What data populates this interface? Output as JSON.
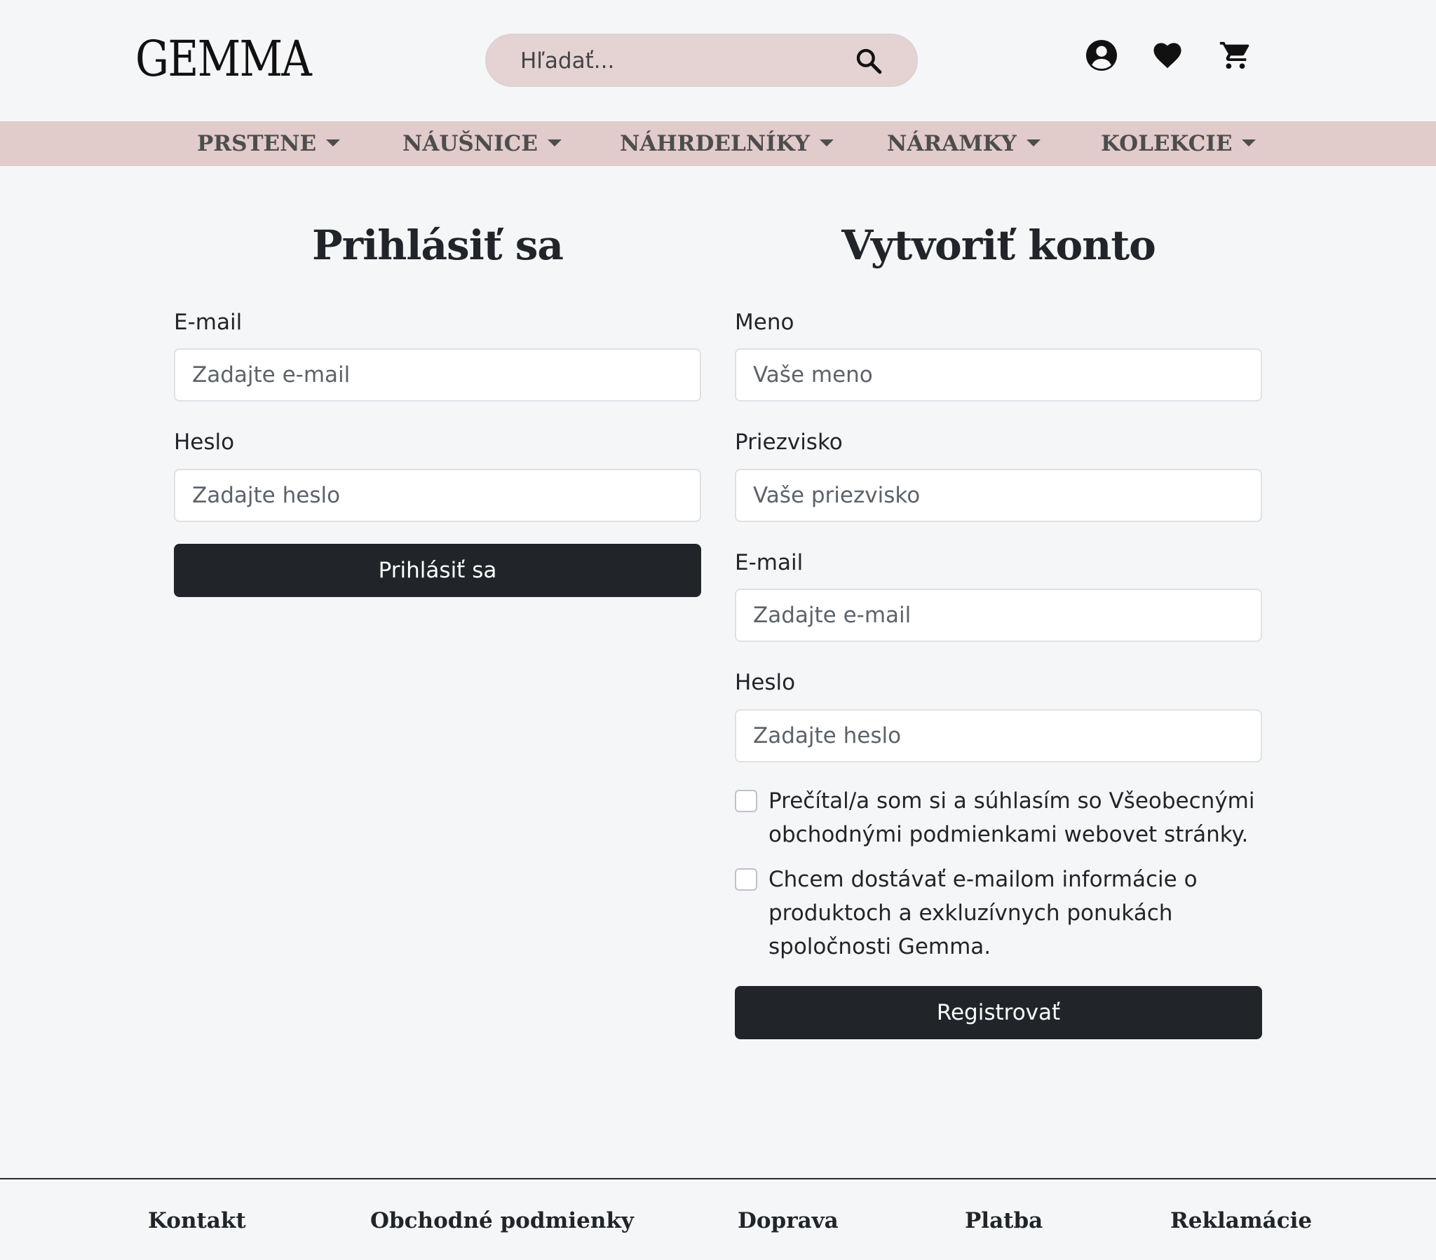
{
  "brand": {
    "logo": "GEMMA"
  },
  "search": {
    "placeholder": "Hľadať..."
  },
  "header_icons": [
    "account-icon",
    "heart-icon",
    "cart-icon"
  ],
  "nav": {
    "items": [
      {
        "label": "PRSTENE"
      },
      {
        "label": "NÁUŠNICE"
      },
      {
        "label": "NÁHRDELNÍKY"
      },
      {
        "label": "NÁRAMKY"
      },
      {
        "label": "KOLEKCIE"
      }
    ]
  },
  "login": {
    "title": "Prihlásiť sa",
    "email_label": "E-mail",
    "email_placeholder": "Zadajte e-mail",
    "password_label": "Heslo",
    "password_placeholder": "Zadajte heslo",
    "submit_label": "Prihlásiť sa"
  },
  "register": {
    "title": "Vytvoriť konto",
    "name_label": "Meno",
    "name_placeholder": "Vaše meno",
    "surname_label": "Priezvisko",
    "surname_placeholder": "Vaše priezvisko",
    "email_label": "E-mail",
    "email_placeholder": "Zadajte e-mail",
    "password_label": "Heslo",
    "password_placeholder": "Zadajte heslo",
    "terms_text": "Prečítal/a som si a súhlasím so Všeobecnými obchodnými podmienkami webovet stránky.",
    "newsletter_text": "Chcem dostávať e-mailom informácie o produktoch a exkluzívnych ponukách spoločnosti Gemma.",
    "submit_label": "Registrovať"
  },
  "footer": {
    "links": [
      "Kontakt",
      "Obchodné podmienky",
      "Doprava",
      "Platba",
      "Reklamácie"
    ]
  },
  "colors": {
    "background": "#f5f6f8",
    "accent": "#e2cbcb",
    "search_bg": "#e5d3d3",
    "button": "#212529"
  }
}
